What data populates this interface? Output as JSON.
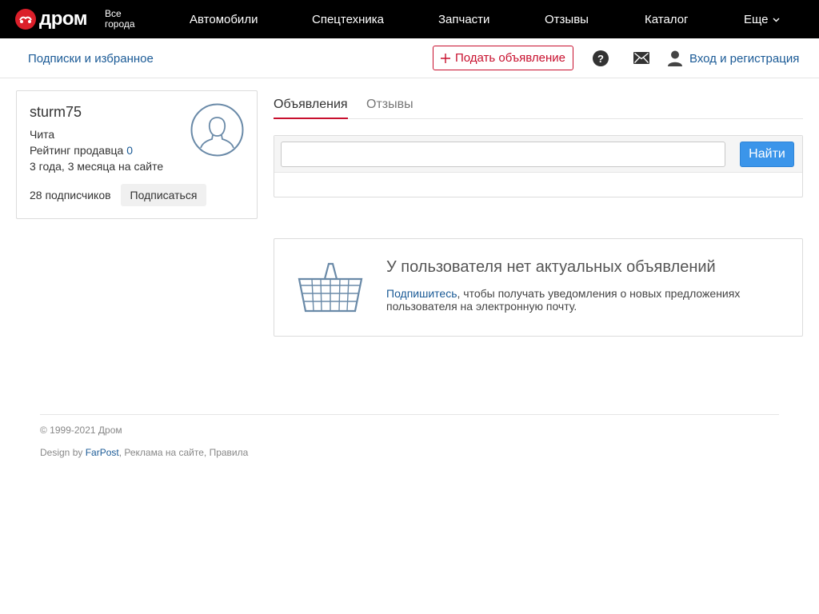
{
  "header": {
    "logo_text": "дром",
    "city_line1": "Все",
    "city_line2": "города",
    "nav": [
      "Автомобили",
      "Спецтехника",
      "Запчасти",
      "Отзывы",
      "Каталог",
      "Еще"
    ],
    "brand_color": "#db1f2a"
  },
  "subbar": {
    "subscriptions_link": "Подписки и избранное",
    "post_ad_label": "Подать объявление",
    "help_glyph": "?",
    "login_link": "Вход и регистрация"
  },
  "profile": {
    "username": "sturm75",
    "city": "Чита",
    "rating_label": "Рейтинг продавца",
    "rating_value": "0",
    "since": "3 года, 3 месяца на сайте",
    "subscribers": "28 подписчиков",
    "subscribe_button": "Подписаться",
    "avatar_icon": "user-silhouette-icon"
  },
  "tabs": {
    "ads": "Объявления",
    "reviews": "Отзывы",
    "active": "ads"
  },
  "search": {
    "value": "",
    "placeholder": "",
    "button_label": "Найти",
    "button_color": "#3b95ea"
  },
  "empty_state": {
    "icon": "basket-icon",
    "title": "У пользователя нет актуальных объявлений",
    "link_text": "Подпишитесь",
    "text": ", чтобы получать уведомления о новых предложениях пользователя на электронную почту."
  },
  "footer": {
    "copyright": "© 1999-2021 Дром",
    "design_prefix": "Design by ",
    "design_link": "FarPost",
    "design_suffix": ", Реклама на сайте, Правила"
  }
}
